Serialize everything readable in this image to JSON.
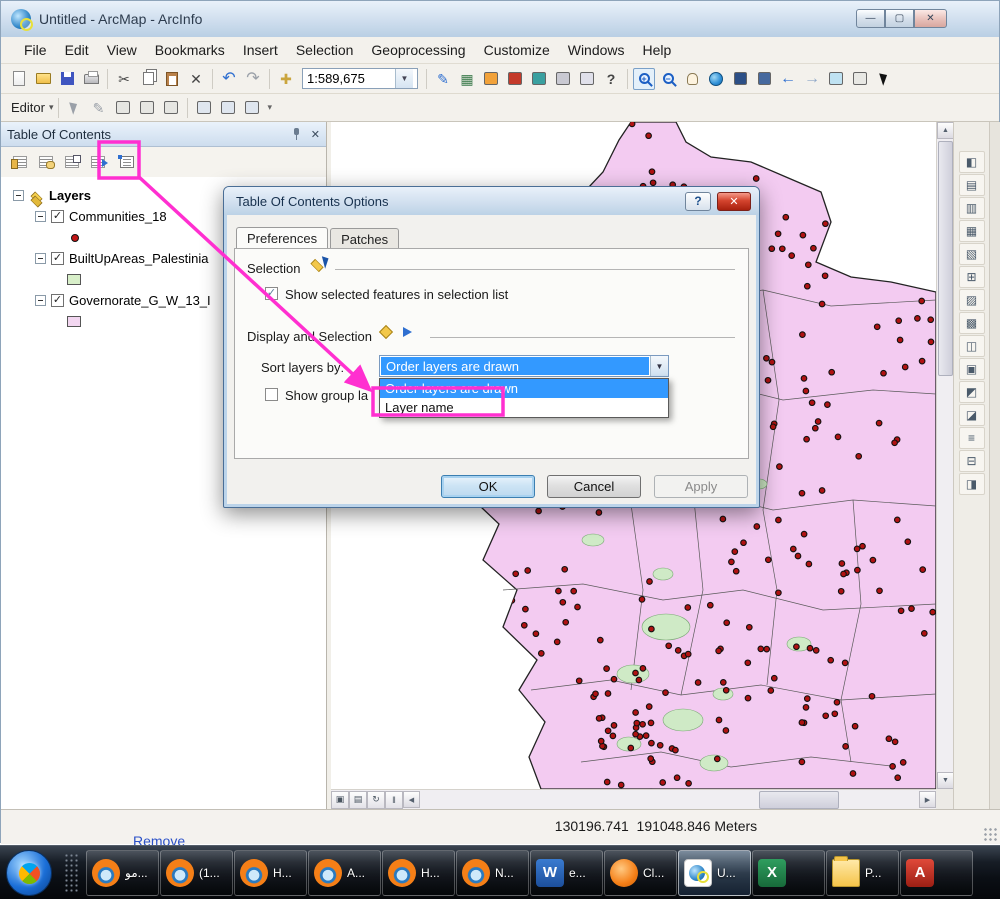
{
  "window": {
    "title": "Untitled - ArcMap - ArcInfo"
  },
  "menu": {
    "items": [
      "File",
      "Edit",
      "View",
      "Bookmarks",
      "Insert",
      "Selection",
      "Geoprocessing",
      "Customize",
      "Windows",
      "Help"
    ]
  },
  "toolbar": {
    "scale_value": "1:589,675"
  },
  "editor_toolbar": {
    "label": "Editor"
  },
  "toc": {
    "title": "Table Of Contents",
    "root_label": "Layers",
    "layers": [
      {
        "label": "Communities_18",
        "symbol": "red-dot"
      },
      {
        "label": "BuiltUpAreas_Palestinia",
        "symbol": "green-square"
      },
      {
        "label": "Governorate_G_W_13_I",
        "symbol": "pink-square"
      }
    ]
  },
  "dialog": {
    "title": "Table Of Contents Options",
    "tabs": [
      "Preferences",
      "Patches"
    ],
    "selection_label": "Selection",
    "show_selected_label": "Show selected features in selection list",
    "display_label": "Display and Selection",
    "sort_label": "Sort layers by:",
    "sort_value": "Order layers are drawn",
    "options": [
      "Order layers are drawn",
      "Layer name"
    ],
    "group_label": "Show group la",
    "ok": "OK",
    "cancel": "Cancel",
    "apply": "Apply"
  },
  "status": {
    "coordinates": "130196.741  191048.846 Meters"
  },
  "background": {
    "remove_label": "Remove"
  },
  "taskbar": {
    "items": [
      {
        "app": "firefox",
        "label": "مو..."
      },
      {
        "app": "firefox",
        "label": "(1..."
      },
      {
        "app": "firefox",
        "label": "H..."
      },
      {
        "app": "firefox",
        "label": "A..."
      },
      {
        "app": "firefox",
        "label": "H..."
      },
      {
        "app": "firefox",
        "label": "N..."
      },
      {
        "app": "word",
        "label": "e..."
      },
      {
        "app": "app-orange",
        "label": "Cl..."
      },
      {
        "app": "arcmap",
        "label": "U..."
      },
      {
        "app": "excel",
        "label": ""
      },
      {
        "app": "folder",
        "label": "P..."
      },
      {
        "app": "adobe",
        "label": ""
      }
    ]
  },
  "icons": {
    "cut": "✂",
    "delete": "✕",
    "undo": "↶",
    "redo": "↷",
    "add_data": "✚",
    "pencil": "✎",
    "back": "←",
    "forward": "→",
    "whats_this": "?",
    "table": "▦",
    "check": "✓",
    "combo_arrow": "▼",
    "overflow": "▾",
    "minimize": "—",
    "maximize": "▢",
    "close": "✕",
    "help": "?",
    "scroll_left": "◀",
    "scroll_right": "▶",
    "scroll_up": "▲",
    "scroll_down": "▼",
    "refresh": "↻",
    "pause": "‖",
    "data_view": "▣",
    "layout_view": "▤",
    "word_glyph": "W",
    "excel_glyph": "X",
    "adobe_glyph": "A"
  },
  "colors": {
    "annotation": "#ff2fd0",
    "selection_highlight": "#3399ff",
    "map_fill": "#f3cbf1",
    "community_dot": "#b01212"
  }
}
